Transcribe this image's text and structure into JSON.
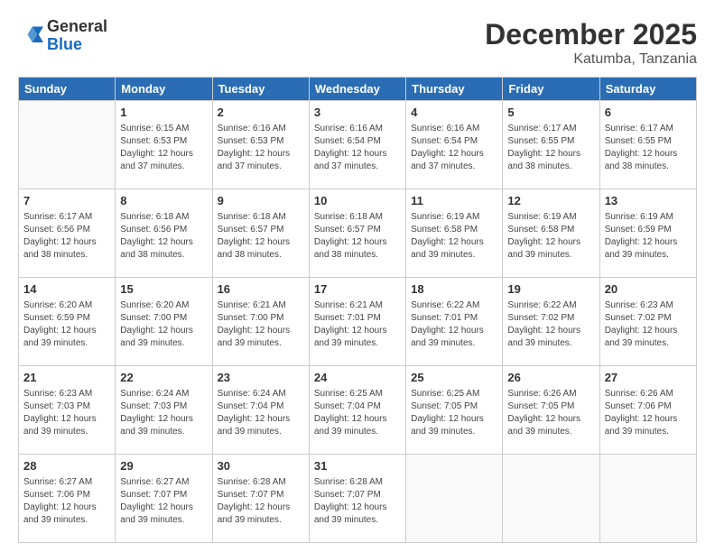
{
  "header": {
    "logo_general": "General",
    "logo_blue": "Blue",
    "month_year": "December 2025",
    "location": "Katumba, Tanzania"
  },
  "weekdays": [
    "Sunday",
    "Monday",
    "Tuesday",
    "Wednesday",
    "Thursday",
    "Friday",
    "Saturday"
  ],
  "weeks": [
    [
      {
        "day": "",
        "empty": true
      },
      {
        "day": "1",
        "sunrise": "6:15 AM",
        "sunset": "6:53 PM",
        "daylight": "12 hours and 37 minutes."
      },
      {
        "day": "2",
        "sunrise": "6:16 AM",
        "sunset": "6:53 PM",
        "daylight": "12 hours and 37 minutes."
      },
      {
        "day": "3",
        "sunrise": "6:16 AM",
        "sunset": "6:54 PM",
        "daylight": "12 hours and 37 minutes."
      },
      {
        "day": "4",
        "sunrise": "6:16 AM",
        "sunset": "6:54 PM",
        "daylight": "12 hours and 37 minutes."
      },
      {
        "day": "5",
        "sunrise": "6:17 AM",
        "sunset": "6:55 PM",
        "daylight": "12 hours and 38 minutes."
      },
      {
        "day": "6",
        "sunrise": "6:17 AM",
        "sunset": "6:55 PM",
        "daylight": "12 hours and 38 minutes."
      }
    ],
    [
      {
        "day": "7",
        "sunrise": "6:17 AM",
        "sunset": "6:56 PM",
        "daylight": "12 hours and 38 minutes."
      },
      {
        "day": "8",
        "sunrise": "6:18 AM",
        "sunset": "6:56 PM",
        "daylight": "12 hours and 38 minutes."
      },
      {
        "day": "9",
        "sunrise": "6:18 AM",
        "sunset": "6:57 PM",
        "daylight": "12 hours and 38 minutes."
      },
      {
        "day": "10",
        "sunrise": "6:18 AM",
        "sunset": "6:57 PM",
        "daylight": "12 hours and 38 minutes."
      },
      {
        "day": "11",
        "sunrise": "6:19 AM",
        "sunset": "6:58 PM",
        "daylight": "12 hours and 39 minutes."
      },
      {
        "day": "12",
        "sunrise": "6:19 AM",
        "sunset": "6:58 PM",
        "daylight": "12 hours and 39 minutes."
      },
      {
        "day": "13",
        "sunrise": "6:19 AM",
        "sunset": "6:59 PM",
        "daylight": "12 hours and 39 minutes."
      }
    ],
    [
      {
        "day": "14",
        "sunrise": "6:20 AM",
        "sunset": "6:59 PM",
        "daylight": "12 hours and 39 minutes."
      },
      {
        "day": "15",
        "sunrise": "6:20 AM",
        "sunset": "7:00 PM",
        "daylight": "12 hours and 39 minutes."
      },
      {
        "day": "16",
        "sunrise": "6:21 AM",
        "sunset": "7:00 PM",
        "daylight": "12 hours and 39 minutes."
      },
      {
        "day": "17",
        "sunrise": "6:21 AM",
        "sunset": "7:01 PM",
        "daylight": "12 hours and 39 minutes."
      },
      {
        "day": "18",
        "sunrise": "6:22 AM",
        "sunset": "7:01 PM",
        "daylight": "12 hours and 39 minutes."
      },
      {
        "day": "19",
        "sunrise": "6:22 AM",
        "sunset": "7:02 PM",
        "daylight": "12 hours and 39 minutes."
      },
      {
        "day": "20",
        "sunrise": "6:23 AM",
        "sunset": "7:02 PM",
        "daylight": "12 hours and 39 minutes."
      }
    ],
    [
      {
        "day": "21",
        "sunrise": "6:23 AM",
        "sunset": "7:03 PM",
        "daylight": "12 hours and 39 minutes."
      },
      {
        "day": "22",
        "sunrise": "6:24 AM",
        "sunset": "7:03 PM",
        "daylight": "12 hours and 39 minutes."
      },
      {
        "day": "23",
        "sunrise": "6:24 AM",
        "sunset": "7:04 PM",
        "daylight": "12 hours and 39 minutes."
      },
      {
        "day": "24",
        "sunrise": "6:25 AM",
        "sunset": "7:04 PM",
        "daylight": "12 hours and 39 minutes."
      },
      {
        "day": "25",
        "sunrise": "6:25 AM",
        "sunset": "7:05 PM",
        "daylight": "12 hours and 39 minutes."
      },
      {
        "day": "26",
        "sunrise": "6:26 AM",
        "sunset": "7:05 PM",
        "daylight": "12 hours and 39 minutes."
      },
      {
        "day": "27",
        "sunrise": "6:26 AM",
        "sunset": "7:06 PM",
        "daylight": "12 hours and 39 minutes."
      }
    ],
    [
      {
        "day": "28",
        "sunrise": "6:27 AM",
        "sunset": "7:06 PM",
        "daylight": "12 hours and 39 minutes."
      },
      {
        "day": "29",
        "sunrise": "6:27 AM",
        "sunset": "7:07 PM",
        "daylight": "12 hours and 39 minutes."
      },
      {
        "day": "30",
        "sunrise": "6:28 AM",
        "sunset": "7:07 PM",
        "daylight": "12 hours and 39 minutes."
      },
      {
        "day": "31",
        "sunrise": "6:28 AM",
        "sunset": "7:07 PM",
        "daylight": "12 hours and 39 minutes."
      },
      {
        "day": "",
        "empty": true
      },
      {
        "day": "",
        "empty": true
      },
      {
        "day": "",
        "empty": true
      }
    ]
  ],
  "labels": {
    "sunrise_prefix": "Sunrise: ",
    "sunset_prefix": "Sunset: ",
    "daylight_prefix": "Daylight: "
  }
}
